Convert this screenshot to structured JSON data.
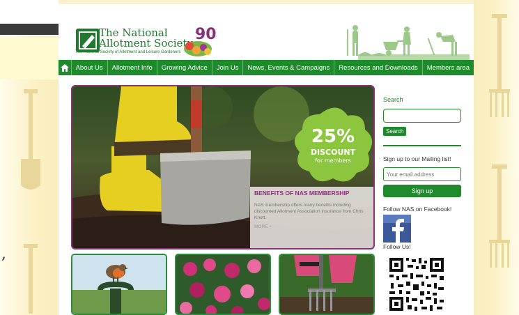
{
  "site": {
    "title_line1": "The National",
    "title_line2": "Allotment Society",
    "subtitle": "The National Society of Allotment and Leisure Gardeners",
    "anniversary": "90"
  },
  "nav": {
    "items": [
      {
        "label": "About Us"
      },
      {
        "label": "Allotment Info"
      },
      {
        "label": "Growing Advice"
      },
      {
        "label": "Join Us"
      },
      {
        "label": "News, Events & Campaigns"
      },
      {
        "label": "Resources and Downloads"
      },
      {
        "label": "Members area"
      }
    ]
  },
  "hero": {
    "discount_value": "25%",
    "discount_word": "DISCOUNT",
    "discount_for": "for members",
    "promo_title": "BENEFITS OF NAS MEMBERSHIP",
    "promo_text": "NAS membership offers many benefits including discounted Allotment Association insurance from Chris Knott.",
    "promo_more": "MORE +"
  },
  "sidebar": {
    "search_label": "Search",
    "search_button": "Search",
    "mailing_label": "Sign up to our Mailing list!",
    "email_placeholder": "Your email address",
    "signup_button": "Sign up",
    "facebook_label": "Follow NAS on Facebook!",
    "follow_label": "Follow Us!"
  },
  "background": {
    "side_text": ","
  },
  "colors": {
    "brand_green": "#1f8a2c",
    "accent_purple": "#8a2f7a",
    "cream": "#fbf3cf"
  }
}
